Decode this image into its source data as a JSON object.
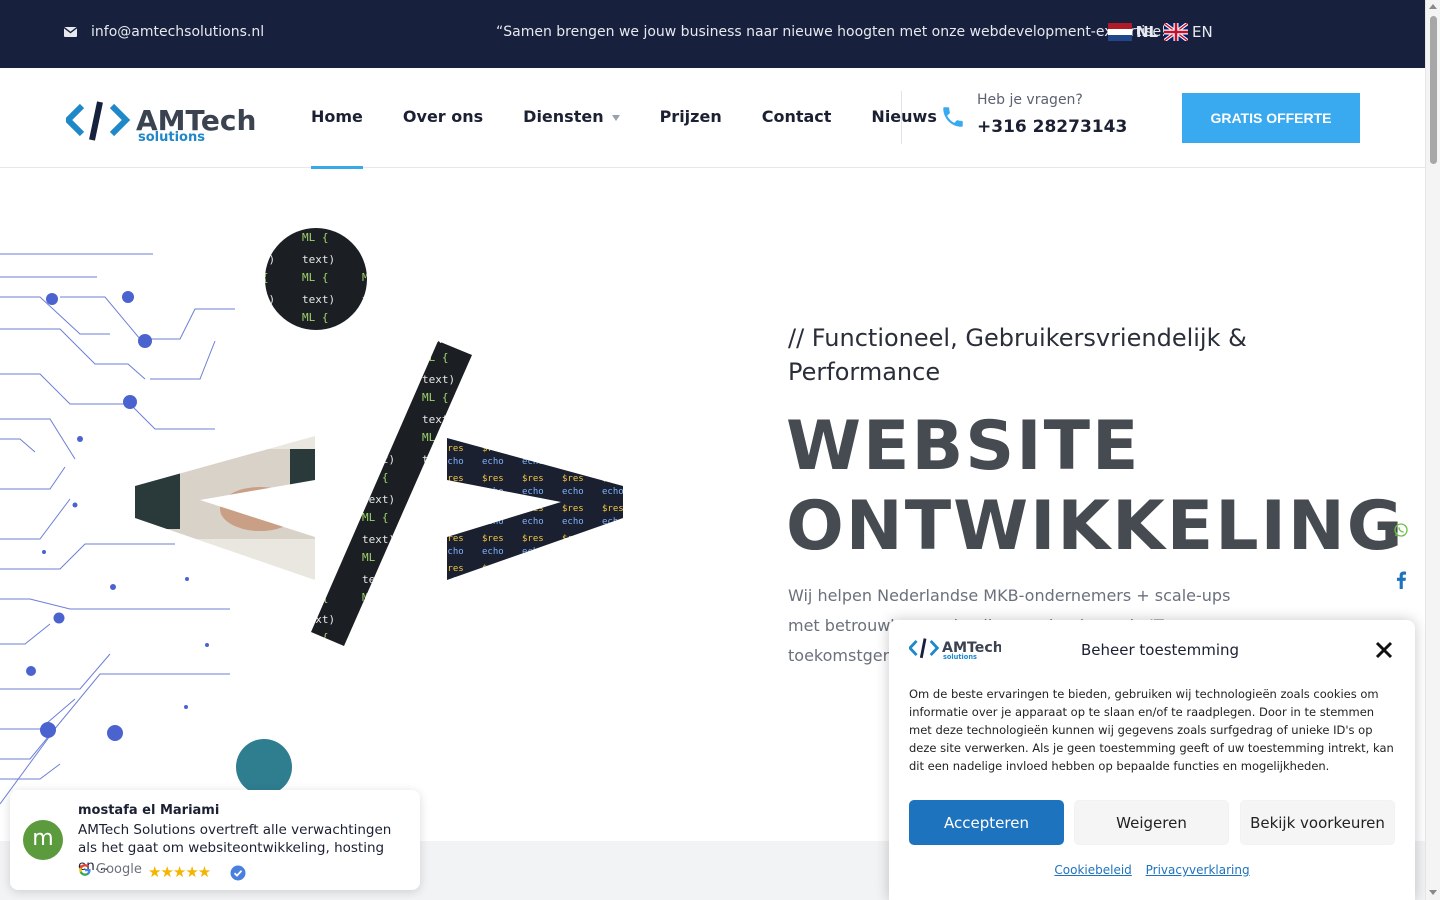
{
  "topbar": {
    "email": "info@amtechsolutions.nl",
    "quote": "“Samen brengen we jouw business naar nieuwe hoogten met onze webdevelopment-expertise!”",
    "lang_nl": "NL",
    "lang_en": "EN"
  },
  "logo": {
    "name": "AMTech",
    "sub": "solutions"
  },
  "nav": {
    "items": [
      "Home",
      "Over ons",
      "Diensten",
      "Prijzen",
      "Contact",
      "Nieuws"
    ],
    "active": "Home"
  },
  "contact": {
    "label": "Heb je vragen?",
    "phone": "+316 28273143"
  },
  "cta": {
    "label": "GRATIS OFFERTE"
  },
  "hero": {
    "tagline": "// Functioneel, Gebruikersvriendelijk & Performance",
    "title_line1": "WEBSITE",
    "title_line2": "ONTWIKKELING",
    "intro": "Wij helpen Nederlandse MKB-ondernemers + scale-ups met betrouwbare, schaalbare oplossingen in IT-toekomstgerichte software."
  },
  "review": {
    "avatar_letter": "m",
    "name": "mostafa el Mariami",
    "text": "AMTech Solutions overtreft alle verwachtingen als het gaat om websiteontwikkeling, hosting en…",
    "source": "Google",
    "stars": "★★★★★",
    "rating": 5
  },
  "cookie": {
    "title": "Beheer toestemming",
    "body": "Om de beste ervaringen te bieden, gebruiken wij technologieën zoals cookies om informatie over je apparaat op te slaan en/of te raadplegen. Door in te stemmen met deze technologieën kunnen wij gegevens zoals surfgedrag of unieke ID's op deze site verwerken. Als je geen toestemming geeft of uw toestemming intrekt, kan dit een nadelige invloed hebben op bepaalde functies en mogelijkheden.",
    "accept": "Accepteren",
    "deny": "Weigeren",
    "prefs": "Bekijk voorkeuren",
    "link_cookie": "Cookiebeleid",
    "link_privacy": "Privacyverklaring"
  },
  "social": [
    "whatsapp-icon",
    "facebook-icon",
    "tiktok-icon"
  ],
  "colors": {
    "topbar": "#17203d",
    "accent": "#3aaaf0",
    "accept": "#1e73be",
    "title": "#464a51"
  }
}
